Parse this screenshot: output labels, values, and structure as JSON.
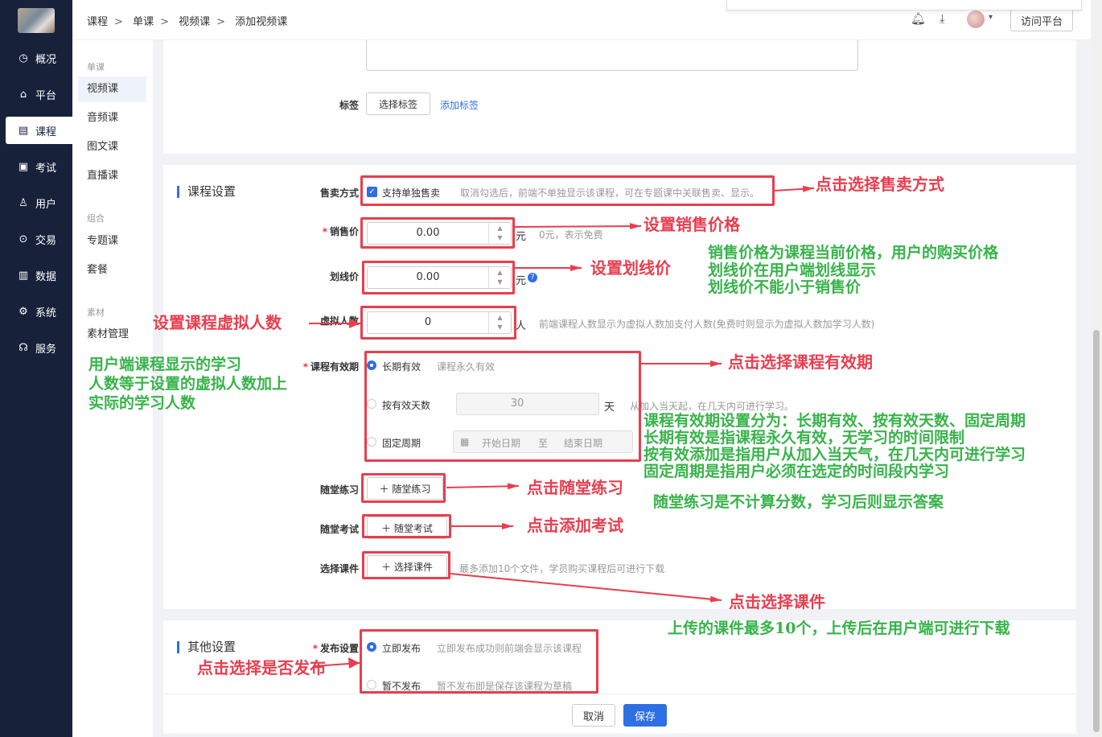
{
  "nav": {
    "items": [
      {
        "label": "概况",
        "icon": "clock-icon"
      },
      {
        "label": "平台",
        "icon": "platform-icon"
      },
      {
        "label": "课程",
        "icon": "book-icon"
      },
      {
        "label": "考试",
        "icon": "exam-icon"
      },
      {
        "label": "用户",
        "icon": "user-icon"
      },
      {
        "label": "交易",
        "icon": "trade-icon"
      },
      {
        "label": "数据",
        "icon": "chart-icon"
      },
      {
        "label": "系统",
        "icon": "gear-icon"
      },
      {
        "label": "服务",
        "icon": "service-icon"
      }
    ]
  },
  "subnav": {
    "group_single": "单课",
    "video": "视频课",
    "audio": "音频课",
    "text": "图文课",
    "live": "直播课",
    "group_combo": "组合",
    "topic": "专题课",
    "package": "套餐",
    "group_material": "素材",
    "material": "素材管理"
  },
  "breadcrumb": [
    "课程",
    "单课",
    "视频课",
    "添加视频课"
  ],
  "header": {
    "visit_label": "访问平台"
  },
  "tags": {
    "label": "标签",
    "select_button": "选择标签",
    "add_link": "添加标签"
  },
  "course_settings": {
    "title": "课程设置",
    "sale_mode": {
      "label": "售卖方式",
      "checkbox_label": "支持单独售卖",
      "hint": "取消勾选后，前端不单独显示该课程，可在专题课中关联售卖、显示。"
    },
    "price": {
      "label": "销售价",
      "value": "0.00",
      "unit": "元",
      "hint": "0元，表示免费"
    },
    "strike_price": {
      "label": "划线价",
      "value": "0.00",
      "unit": "元"
    },
    "virtual_count": {
      "label": "虚拟人数",
      "value": "0",
      "unit": "人",
      "hint": "前端课程人数显示为虚拟人数加支付人数(免费时则显示为虚拟人数加学习人数)"
    },
    "validity": {
      "label": "课程有效期",
      "long_term": "长期有效",
      "long_term_hint": "课程永久有效",
      "by_days": "按有效天数",
      "days_value": "30",
      "days_unit": "天",
      "days_hint": "从加入当天起，在几天内可进行学习。",
      "fixed": "固定周期",
      "start_placeholder": "开始日期",
      "to": "至",
      "end_placeholder": "结束日期"
    },
    "practice": {
      "label": "随堂练习",
      "button": "随堂练习"
    },
    "exam": {
      "label": "随堂考试",
      "button": "随堂考试"
    },
    "courseware": {
      "label": "选择课件",
      "button": "选择课件",
      "hint": "最多添加10个文件，学员购买课程后可进行下载"
    }
  },
  "other_settings": {
    "title": "其他设置",
    "publish": {
      "label": "发布设置",
      "now": "立即发布",
      "now_hint": "立即发布成功则前端会显示该课程",
      "later": "暂不发布",
      "later_hint": "暂不发布即是保存该课程为草稿"
    }
  },
  "footer": {
    "cancel": "取消",
    "save": "保存"
  },
  "annotations": {
    "sale_mode": "点击选择售卖方式",
    "price": "设置销售价格",
    "strike": "设置划线价",
    "price_note_1": "销售价格为课程当前价格，用户的购买价格",
    "price_note_2": "划线价在用户端划线显示",
    "price_note_3": "划线价不能小于销售价",
    "virtual": "设置课程虚拟人数",
    "virtual_note_1": "用户端课程显示的学习",
    "virtual_note_2": "人数等于设置的虚拟人数加上",
    "virtual_note_3": "实际的学习人数",
    "validity": "点击选择课程有效期",
    "validity_note_1": "课程有效期设置分为：长期有效、按有效天数、固定周期",
    "validity_note_2": "长期有效是指课程永久有效，无学习的时间限制",
    "validity_note_3": "按有效添加是指用户从加入当天气，在几天内可进行学习",
    "validity_note_4": "固定周期是指用户必须在选定的时间段内学习",
    "practice": "点击随堂练习",
    "practice_note": "随堂练习是不计算分数，学习后则显示答案",
    "exam": "点击添加考试",
    "courseware": "点击选择课件",
    "courseware_note": "上传的课件最多10个，上传后在用户端可进行下载",
    "publish": "点击选择是否发布",
    "annotation_color": "#e83e4f",
    "note_color": "#37b34a"
  }
}
